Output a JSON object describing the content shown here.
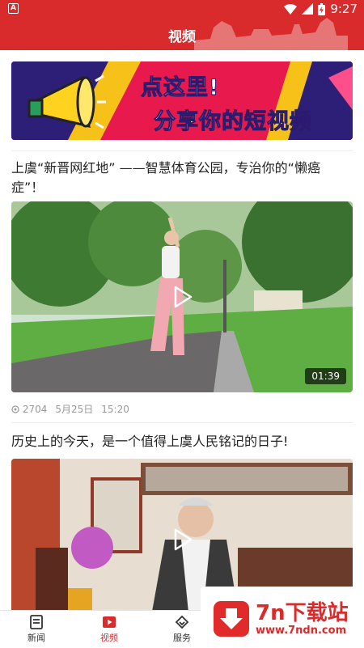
{
  "status": {
    "time": "9:27",
    "left_icon": "A"
  },
  "header": {
    "title": "视频"
  },
  "banner": {
    "line1": "点这里!",
    "line2": "分享你的短视频"
  },
  "feed": [
    {
      "title": "上虞“新晋网红地” ——智慧体育公园，专治你的“懒癌症”！",
      "duration": "01:39",
      "views": "2704",
      "date": "5月25日",
      "time": "15:20"
    },
    {
      "title": "历史上的今天，是一个值得上虞人民铭记的日子!"
    }
  ],
  "tabs": [
    {
      "label": "新闻",
      "icon": "news-icon"
    },
    {
      "label": "视频",
      "icon": "video-icon"
    },
    {
      "label": "服务",
      "icon": "service-icon"
    }
  ],
  "watermark": {
    "name": "7n下载站",
    "url": "www.7ndn.com"
  },
  "colors": {
    "brand": "#d92b2b"
  }
}
